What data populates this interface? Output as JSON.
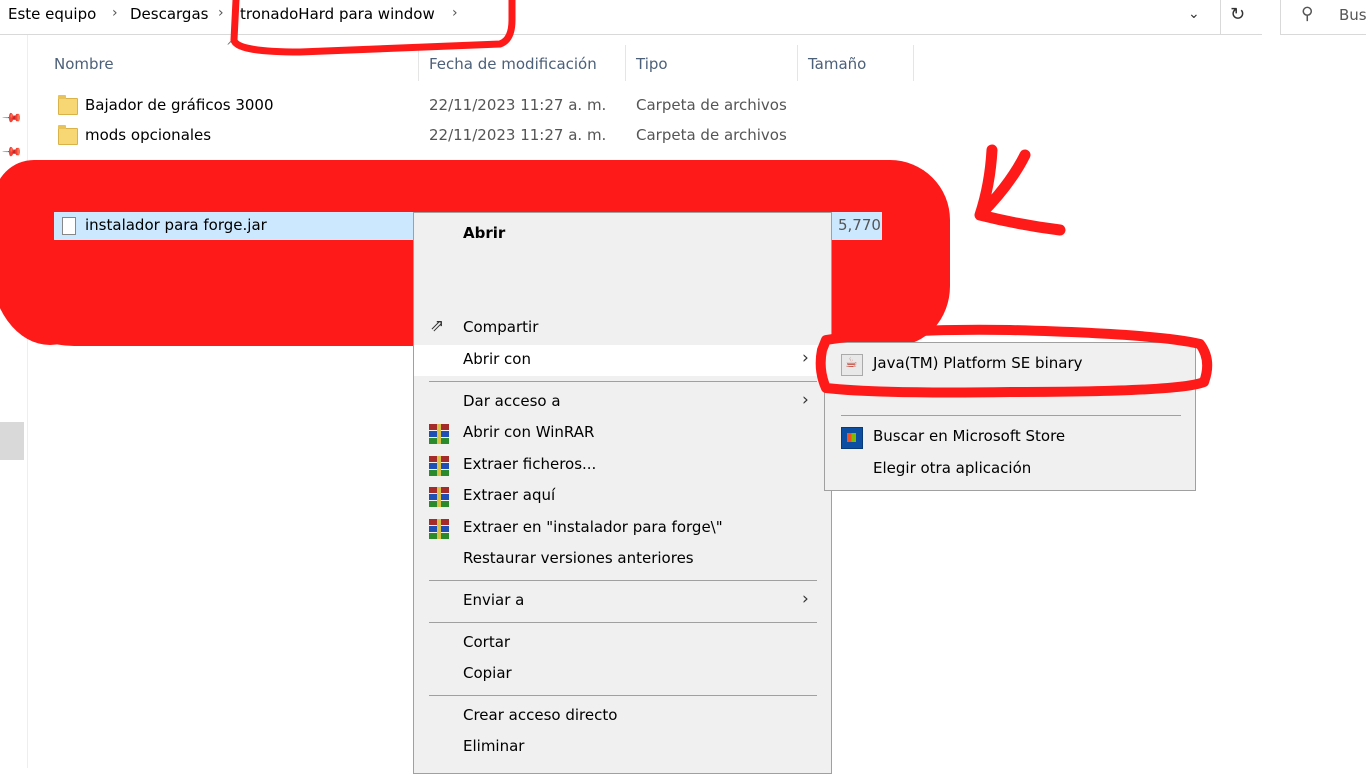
{
  "addressbar": {
    "crumbs": [
      "Este equipo",
      "Descargas",
      "tronadoHard para window"
    ],
    "search_placeholder": "Bus"
  },
  "columns": {
    "name": "Nombre",
    "date": "Fecha de modificación",
    "type": "Tipo",
    "size": "Tamaño"
  },
  "files": [
    {
      "name": "Bajador de gráficos 3000",
      "date": "22/11/2023 11:27 a. m.",
      "type": "Carpeta de archivos"
    },
    {
      "name": "mods opcionales",
      "date": "22/11/2023 11:27 a. m.",
      "type": "Carpeta de archivos"
    }
  ],
  "selected_file": {
    "name": "instalador para forge.jar",
    "size_fragment": "5,770"
  },
  "context_menu": {
    "items": [
      {
        "label": "Abrir"
      },
      {
        "label": "Compartir"
      },
      {
        "label": "Abrir con"
      },
      {
        "label": "Dar acceso a"
      },
      {
        "label": "Abrir con WinRAR"
      },
      {
        "label": "Extraer ficheros..."
      },
      {
        "label": "Extraer aquí"
      },
      {
        "label": "Extraer en \"instalador para forge\\\""
      },
      {
        "label": "Restaurar versiones anteriores"
      },
      {
        "label": "Enviar a"
      },
      {
        "label": "Cortar"
      },
      {
        "label": "Copiar"
      },
      {
        "label": "Crear acceso directo"
      },
      {
        "label": "Eliminar"
      }
    ]
  },
  "submenu": {
    "items": [
      {
        "label": "Java(TM) Platform SE binary",
        "icon": "java-icon"
      },
      {
        "label": "Buscar en Microsoft Store",
        "icon": "microsoft-store-icon"
      },
      {
        "label": "Elegir otra aplicación"
      }
    ]
  },
  "colors": {
    "annotation_red": "#ff1a1a",
    "selection_blue": "#cce8ff",
    "menu_background": "#f0f0f0"
  }
}
